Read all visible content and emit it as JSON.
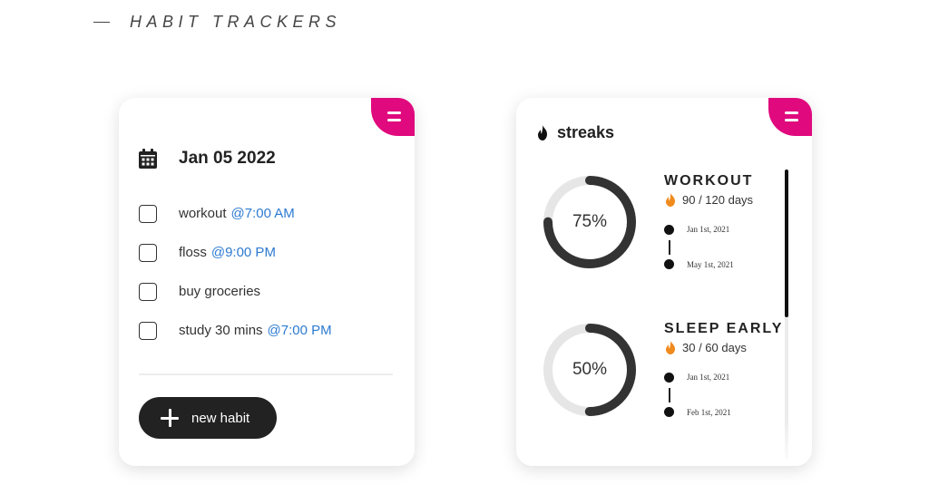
{
  "page": {
    "heading": "HABIT TRACKERS"
  },
  "today_card": {
    "date": "Jan 05 2022",
    "habits": [
      {
        "name": "workout",
        "time": "@7:00 AM"
      },
      {
        "name": "floss",
        "time": "@9:00 PM"
      },
      {
        "name": "buy groceries",
        "time": ""
      },
      {
        "name": "study 30 mins",
        "time": "@7:00 PM"
      }
    ],
    "new_habit_label": "new habit"
  },
  "streaks_card": {
    "title": "streaks",
    "items": [
      {
        "name": "WORKOUT",
        "percent_label": "75%",
        "percent": 75,
        "days": "90 / 120 days",
        "start": "Jan 1st, 2021",
        "end": "May 1st, 2021"
      },
      {
        "name": "SLEEP EARLY",
        "percent_label": "50%",
        "percent": 50,
        "days": "30 / 60 days",
        "start": "Jan 1st, 2021",
        "end": "Feb 1st, 2021"
      }
    ]
  },
  "colors": {
    "accent": "#e0097d",
    "link_time": "#2d7bd2",
    "dark": "#222222",
    "ring_track": "#e6e6e6",
    "ring_fill": "#333333",
    "flame_orange": "#f08a1c"
  },
  "icons": {
    "menu": "hamburger-menu-icon",
    "calendar": "calendar-icon",
    "plus": "plus-icon",
    "flame": "flame-icon"
  }
}
